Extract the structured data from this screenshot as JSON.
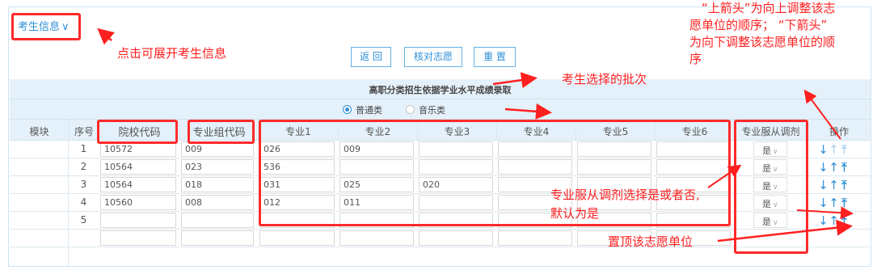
{
  "header": {
    "toggle_label": "考生信息",
    "toggle_chevron": "∨"
  },
  "buttons": {
    "back": "返 回",
    "verify": "核对志愿",
    "reset": "重 置"
  },
  "batch": {
    "title": "高职分类招生依据学业水平成绩录取",
    "options": [
      {
        "label": "普通类",
        "selected": true
      },
      {
        "label": "音乐类",
        "selected": false
      }
    ]
  },
  "table": {
    "columns": {
      "module": "模块",
      "index": "序号",
      "school_code": "院校代码",
      "group_code": "专业组代码",
      "major1": "专业1",
      "major2": "专业2",
      "major3": "专业3",
      "major4": "专业4",
      "major5": "专业5",
      "major6": "专业6",
      "adjust": "专业服从调剂",
      "ops": "操作"
    },
    "rows": [
      {
        "index": "1",
        "school": "10572",
        "group": "009",
        "m1": "026",
        "m2": "009",
        "m3": "",
        "adjust": "是"
      },
      {
        "index": "2",
        "school": "10564",
        "group": "023",
        "m1": "536",
        "m2": "",
        "m3": "",
        "adjust": "是"
      },
      {
        "index": "3",
        "school": "10564",
        "group": "018",
        "m1": "031",
        "m2": "025",
        "m3": "020",
        "adjust": "是"
      },
      {
        "index": "4",
        "school": "10560",
        "group": "008",
        "m1": "012",
        "m2": "011",
        "m3": "",
        "adjust": "是"
      },
      {
        "index": "5",
        "school": "",
        "group": "",
        "m1": "",
        "m2": "",
        "m3": "",
        "adjust": "是"
      }
    ],
    "op_glyphs": {
      "down": "↓",
      "up": "↑",
      "top": "⤒"
    }
  },
  "annotations": {
    "expand": "点击可展开考生信息",
    "batch": "考生选择的批次",
    "arrows_line1": "“上箭头”为向上调整该志",
    "arrows_line2": "愿单位的顺序；  “下箭头”",
    "arrows_line3": "为向下调整该志愿单位的顺",
    "arrows_line4": "序",
    "adjust_line1": "专业服从调剂选择是或者否,",
    "adjust_line2": "默认为是",
    "pin": "置顶该志愿单位"
  },
  "colors": {
    "accent": "#2e8fd8",
    "annotation_red": "#ff1f1f",
    "header_band": "#e4f1fa"
  }
}
